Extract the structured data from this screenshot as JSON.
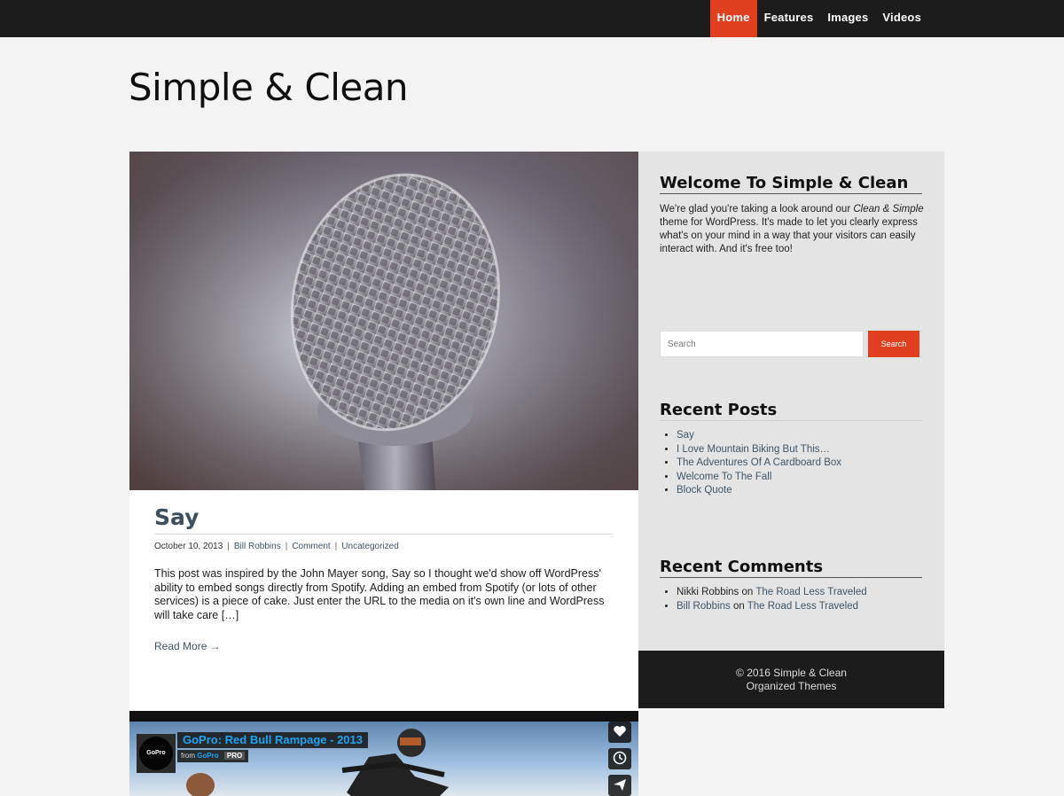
{
  "nav": {
    "items": [
      {
        "label": "Home",
        "active": true
      },
      {
        "label": "Features",
        "active": false
      },
      {
        "label": "Images",
        "active": false
      },
      {
        "label": "Videos",
        "active": false
      }
    ],
    "accent_color": "#e0401f"
  },
  "site": {
    "title": "Simple & Clean"
  },
  "post": {
    "title": "Say",
    "date": "October 10, 2013",
    "author": "Bill Robbins",
    "comment_link": "Comment",
    "category": "Uncategorized",
    "excerpt": "This post was inspired by the John Mayer song, Say so I thought we'd show off WordPress' ability to embed songs directly from Spotify.  Adding an embed from Spotify (or lots of other services) is a piece of cake.  Just enter the URL to the media on it's own line and WordPress will take care […]",
    "read_more": "Read More →"
  },
  "video": {
    "title": "GoPro: Red Bull Rampage - 2013",
    "from_label": "from",
    "channel": "GoPro",
    "badge": "PRO",
    "logo_text": "GoPro",
    "buttons": [
      "heart-icon",
      "clock-icon",
      "send-icon"
    ]
  },
  "sidebar": {
    "welcome": {
      "title": "Welcome To Simple & Clean",
      "text_1": "We're glad you're taking a look around our ",
      "text_italic": "Clean & Simple",
      "text_2": " theme for WordPress. It's made to let you clearly express what's on your mind in a way that your visitors can easily interact with. And it's free too!"
    },
    "search": {
      "placeholder": "Search",
      "button": "Search"
    },
    "recent_posts": {
      "title": "Recent Posts",
      "items": [
        "Say",
        "I Love Mountain Biking But This…",
        "The Adventures Of A Cardboard Box",
        "Welcome To The Fall",
        "Block Quote"
      ]
    },
    "recent_comments": {
      "title": "Recent Comments",
      "items": [
        {
          "author": "Nikki Robbins",
          "on": "on",
          "post": "The Road Less Traveled"
        },
        {
          "author": "Bill Robbins",
          "on": "on",
          "post": "The Road Less Traveled"
        }
      ]
    }
  },
  "footer": {
    "line1": "© 2016 Simple & Clean",
    "line2": "Organized Themes"
  }
}
